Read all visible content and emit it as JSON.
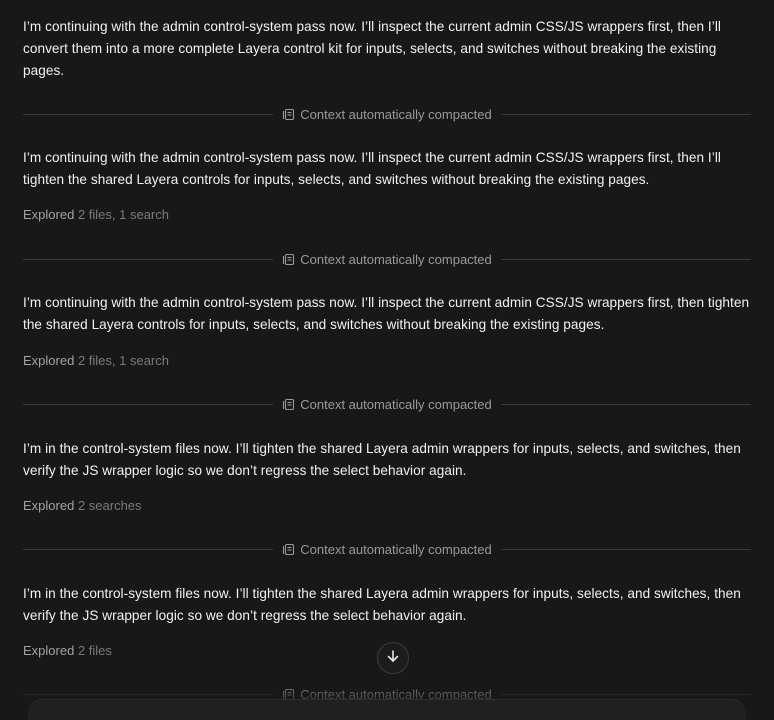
{
  "colors": {
    "background": "#181818",
    "text": "#f2f2f2",
    "muted": "#a3a3a3",
    "divider": "#3a3a3a"
  },
  "compact_label": "Context automatically compacted",
  "messages": [
    {
      "text": "I’m continuing with the admin control-system pass now. I’ll inspect the current admin CSS/JS wrappers first, then I’ll convert them into a more complete Layera control kit for inputs, selects, and switches without breaking the existing pages."
    },
    {
      "text": "I’m continuing with the admin control-system pass now. I’ll inspect the current admin CSS/JS wrappers first, then I’ll tighten the shared Layera controls for inputs, selects, and switches without breaking the existing pages.",
      "explored_label": "Explored",
      "explored_detail": "2 files, 1 search"
    },
    {
      "text": "I’m continuing with the admin control-system pass now. I’ll inspect the current admin CSS/JS wrappers first, then tighten the shared Layera controls for inputs, selects, and switches without breaking the existing pages.",
      "explored_label": "Explored",
      "explored_detail": "2 files, 1 search"
    },
    {
      "text": "I’m in the control-system files now. I’ll tighten the shared Layera admin wrappers for inputs, selects, and switches, then verify the JS wrapper logic so we don’t regress the select behavior again.",
      "explored_label": "Explored",
      "explored_detail": "2 searches"
    },
    {
      "text": "I’m in the control-system files now. I’ll tighten the shared Layera admin wrappers for inputs, selects, and switches, then verify the JS wrapper logic so we don’t regress the select behavior again.",
      "explored_label": "Explored",
      "explored_detail": "2 files"
    }
  ],
  "scroll_button_icon": "arrow-down-icon",
  "compact_icon": "context-compact-icon"
}
